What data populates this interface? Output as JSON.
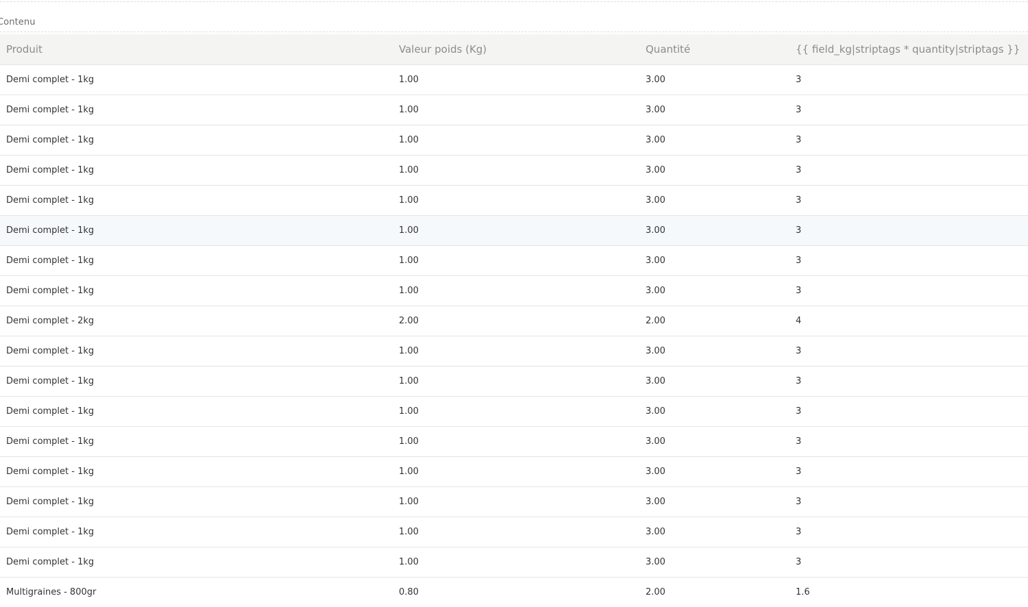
{
  "section": {
    "label": "Contenu"
  },
  "table": {
    "columns": [
      "Produit",
      "Valeur poids (Kg)",
      "Quantité",
      "{{ field_kg|striptags * quantity|striptags }}"
    ],
    "rows": [
      {
        "produit": "Demi complet - 1kg",
        "poids": "1.00",
        "quantite": "3.00",
        "calc": "3"
      },
      {
        "produit": "Demi complet - 1kg",
        "poids": "1.00",
        "quantite": "3.00",
        "calc": "3"
      },
      {
        "produit": "Demi complet - 1kg",
        "poids": "1.00",
        "quantite": "3.00",
        "calc": "3"
      },
      {
        "produit": "Demi complet - 1kg",
        "poids": "1.00",
        "quantite": "3.00",
        "calc": "3"
      },
      {
        "produit": "Demi complet - 1kg",
        "poids": "1.00",
        "quantite": "3.00",
        "calc": "3"
      },
      {
        "produit": "Demi complet - 1kg",
        "poids": "1.00",
        "quantite": "3.00",
        "calc": "3"
      },
      {
        "produit": "Demi complet - 1kg",
        "poids": "1.00",
        "quantite": "3.00",
        "calc": "3"
      },
      {
        "produit": "Demi complet - 1kg",
        "poids": "1.00",
        "quantite": "3.00",
        "calc": "3"
      },
      {
        "produit": "Demi complet - 2kg",
        "poids": "2.00",
        "quantite": "2.00",
        "calc": "4"
      },
      {
        "produit": "Demi complet - 1kg",
        "poids": "1.00",
        "quantite": "3.00",
        "calc": "3"
      },
      {
        "produit": "Demi complet - 1kg",
        "poids": "1.00",
        "quantite": "3.00",
        "calc": "3"
      },
      {
        "produit": "Demi complet - 1kg",
        "poids": "1.00",
        "quantite": "3.00",
        "calc": "3"
      },
      {
        "produit": "Demi complet - 1kg",
        "poids": "1.00",
        "quantite": "3.00",
        "calc": "3"
      },
      {
        "produit": "Demi complet - 1kg",
        "poids": "1.00",
        "quantite": "3.00",
        "calc": "3"
      },
      {
        "produit": "Demi complet - 1kg",
        "poids": "1.00",
        "quantite": "3.00",
        "calc": "3"
      },
      {
        "produit": "Demi complet - 1kg",
        "poids": "1.00",
        "quantite": "3.00",
        "calc": "3"
      },
      {
        "produit": "Demi complet - 1kg",
        "poids": "1.00",
        "quantite": "3.00",
        "calc": "3"
      },
      {
        "produit": "Multigraines - 800gr",
        "poids": "0.80",
        "quantite": "2.00",
        "calc": "1.6"
      }
    ],
    "hovered_row": 5
  },
  "colors": {
    "header_bg": "#f4f4f2",
    "hover_bg": "#f5f9fb",
    "border": "#e4e4e4"
  }
}
